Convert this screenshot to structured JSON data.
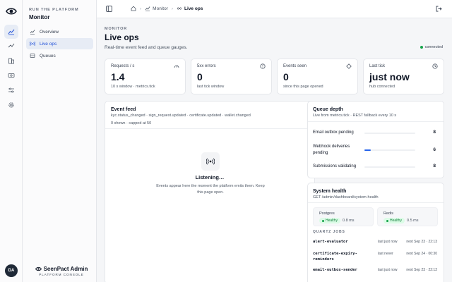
{
  "sidebar": {
    "kicker": "RUN THE PLATFORM",
    "title": "Monitor",
    "items": [
      {
        "label": "Overview",
        "icon": "chart-line-icon"
      },
      {
        "label": "Live ops",
        "icon": "radio-signal-icon"
      },
      {
        "label": "Queues",
        "icon": "queue-stack-icon"
      }
    ],
    "active_item": "Live ops",
    "brand_name": "SeenPact Admin",
    "brand_sub": "PLATFORM CONSOLE",
    "avatar_initials": "DA"
  },
  "breadcrumb": [
    "Monitor",
    "Live ops"
  ],
  "header": {
    "kicker": "MONITOR",
    "title": "Live ops",
    "subtitle": "Real-time event feed and queue gauges.",
    "connection_status": "connected"
  },
  "stats": [
    {
      "label": "Requests / s",
      "value": "1.4",
      "hint": "10 s window · metrics.tick",
      "icon": "gauge-icon"
    },
    {
      "label": "5xx errors",
      "value": "0",
      "hint": "last tick window",
      "icon": "alert-circle-icon"
    },
    {
      "label": "Events seen",
      "value": "0",
      "hint": "since this page opened",
      "icon": "diamond-icon"
    },
    {
      "label": "Last tick",
      "value": "just now",
      "hint": "hub connected",
      "icon": "clock-icon"
    }
  ],
  "event_feed": {
    "title": "Event feed",
    "topics": "kyc.status_changed · sign_request.updated · certificate.updated · wallet.changed",
    "count": "0 shown · capped at 50",
    "empty_title": "Listening…",
    "empty_desc": "Events appear here the moment the platform emits them. Keep this page open."
  },
  "queue_depth": {
    "title": "Queue depth",
    "subtitle": "Live from metrics.tick · REST fallback every 10 s",
    "queues": [
      {
        "name": "Email outbox pending",
        "value": "8",
        "fill": 0
      },
      {
        "name": "Webhook deliveries pending",
        "value": "6",
        "fill": 0.12
      },
      {
        "name": "Submissions validating",
        "value": "8",
        "fill": 0
      }
    ]
  },
  "system_health": {
    "title": "System health",
    "subtitle": "GET /admin/dashboard/system-health",
    "dependencies": [
      {
        "name": "Postgres",
        "status": "Healthy",
        "latency": "0.8 ms"
      },
      {
        "name": "Redis",
        "status": "Healthy",
        "latency": "0.5 ms"
      }
    ],
    "jobs_label": "QUARTZ JOBS",
    "jobs": [
      {
        "name": "alert-evaluator",
        "last": "last just now",
        "next": "next Sep 23 · 22:13"
      },
      {
        "name": "certificate-expiry-reminders",
        "last": "last never",
        "next": "next Sep 24 · 00:30"
      },
      {
        "name": "email-outbox-sender",
        "last": "last just now",
        "next": "next Sep 23 · 22:12"
      }
    ]
  },
  "colors": {
    "accent": "#2563eb",
    "active_bg": "#e7ecf5",
    "healthy": "#16a34a"
  }
}
